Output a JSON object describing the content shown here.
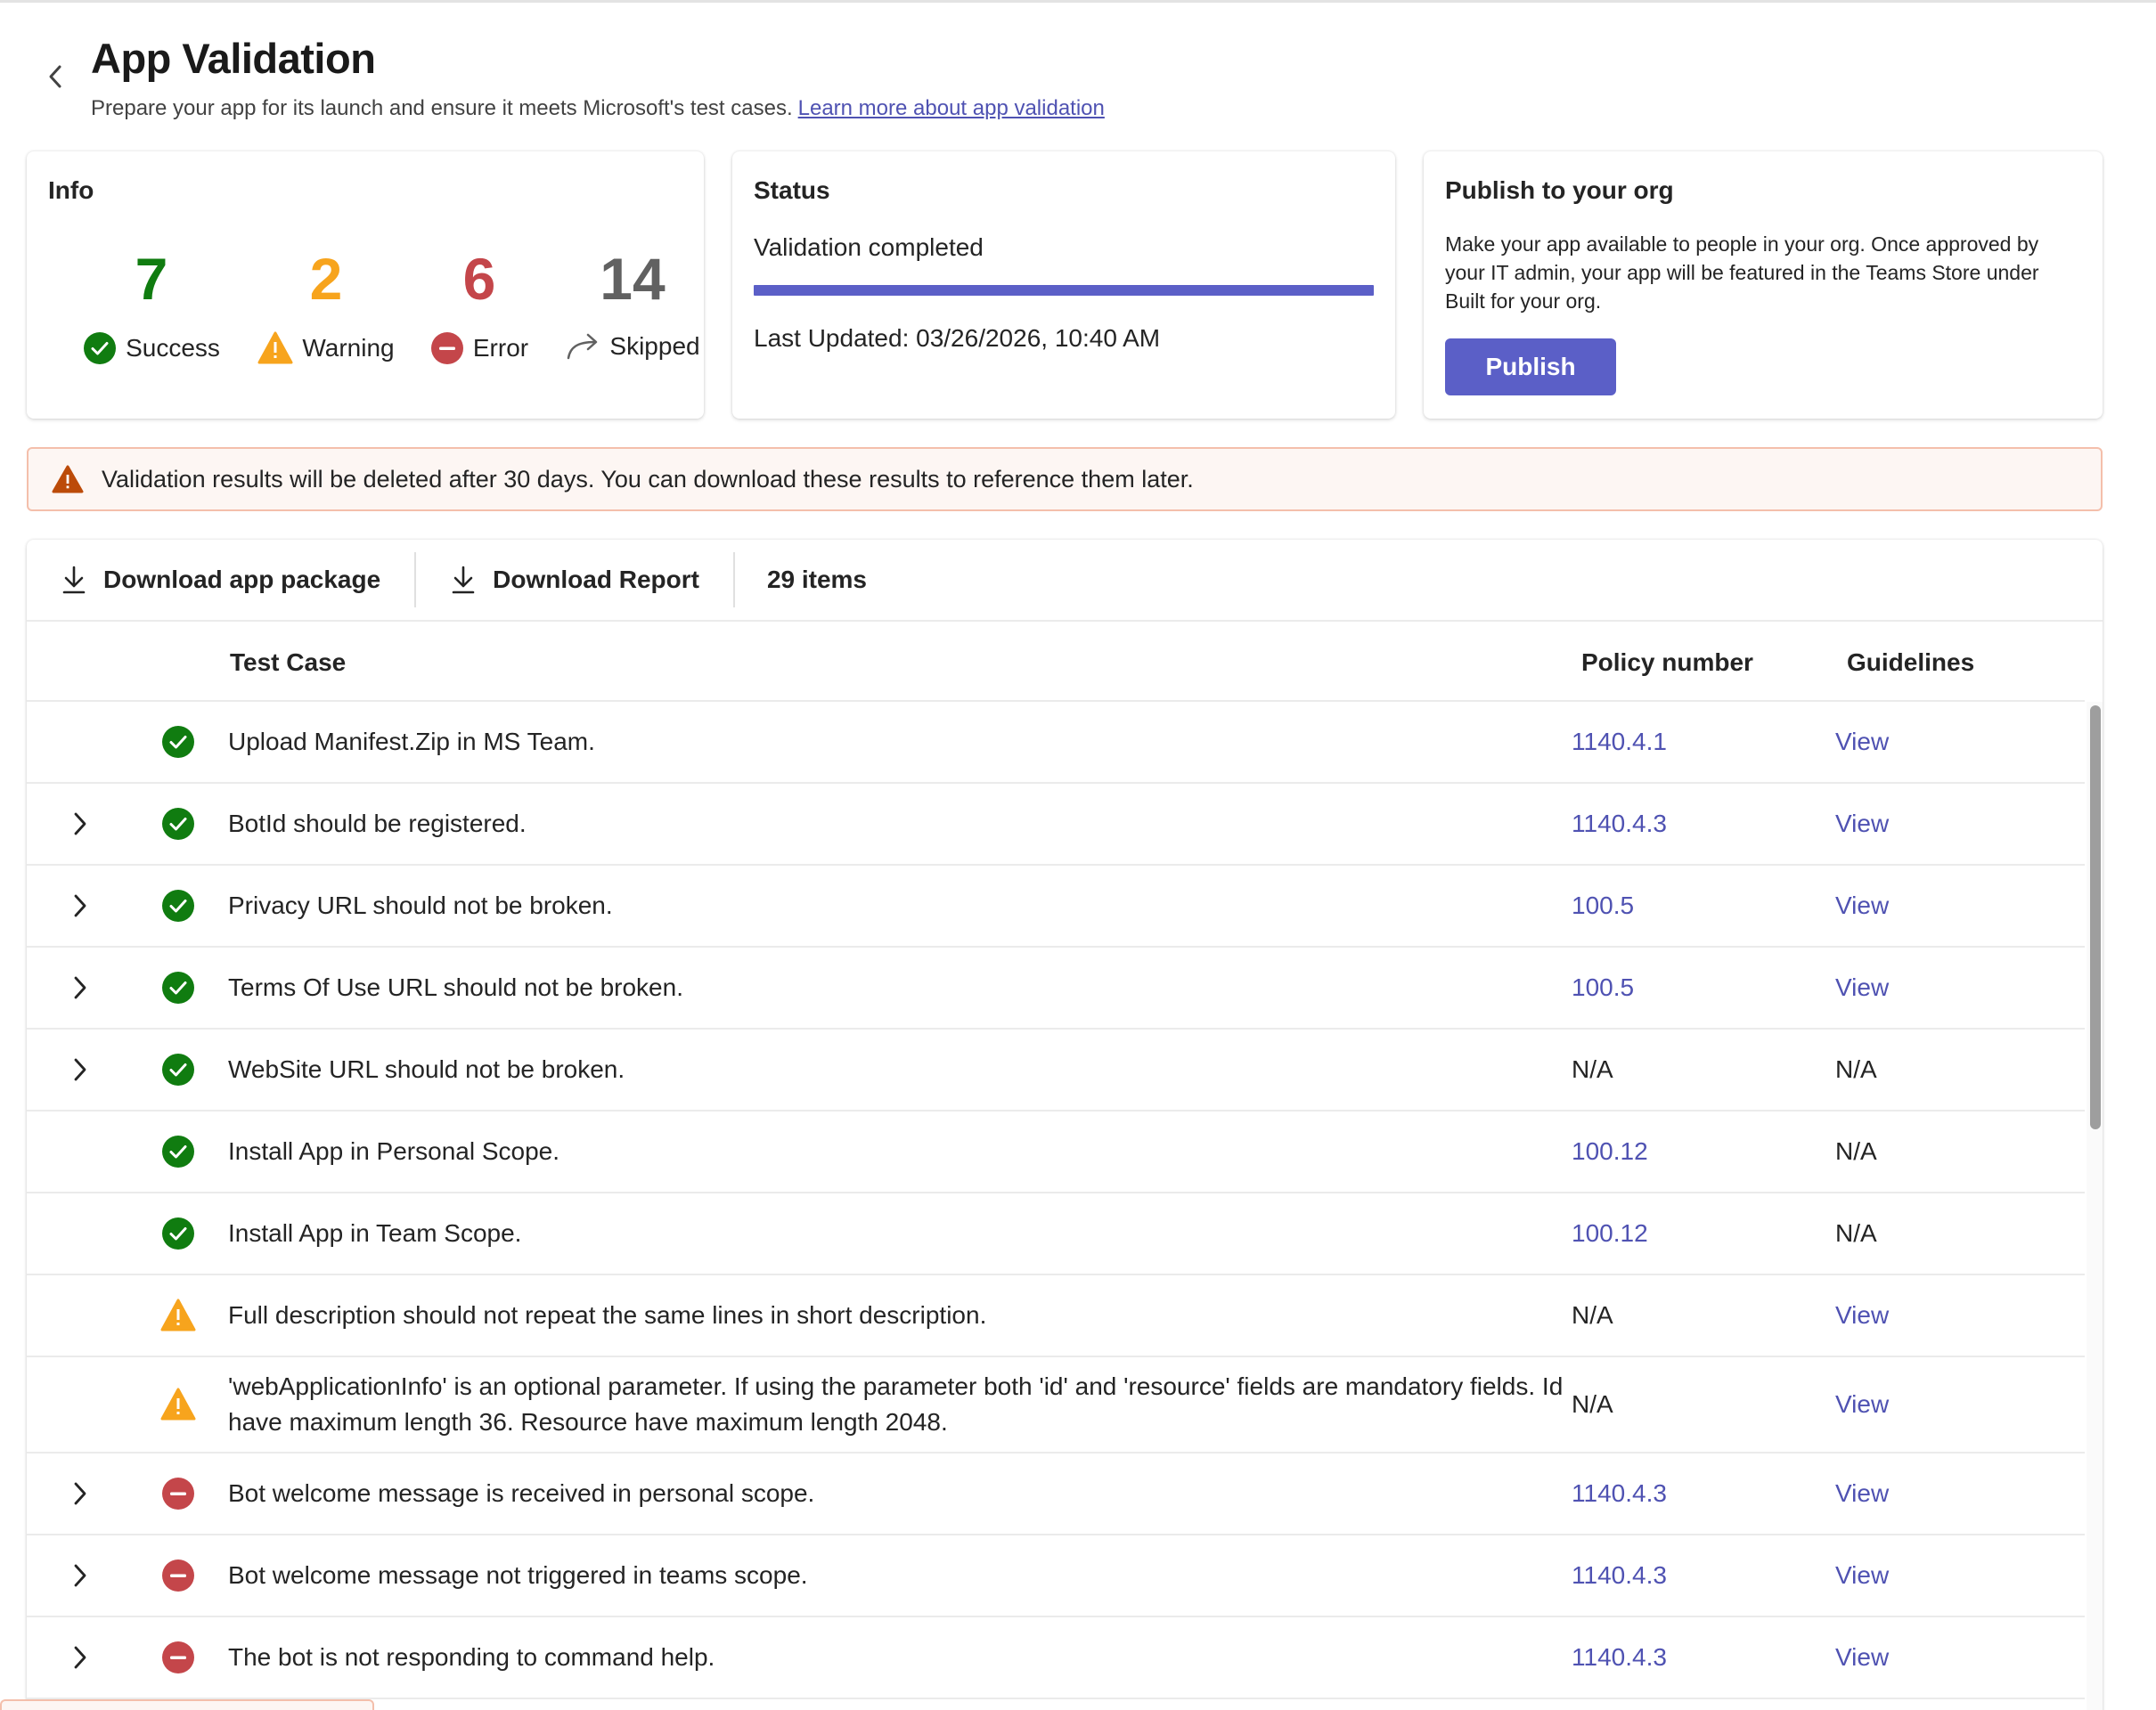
{
  "header": {
    "title": "App Validation",
    "subtitle": "Prepare your app for its launch and ensure it meets Microsoft's test cases.",
    "learn_more": "Learn more about app validation"
  },
  "info": {
    "title": "Info",
    "success": {
      "count": "7",
      "label": "Success"
    },
    "warning": {
      "count": "2",
      "label": "Warning"
    },
    "error": {
      "count": "6",
      "label": "Error"
    },
    "skipped": {
      "count": "14",
      "label": "Skipped"
    }
  },
  "status": {
    "title": "Status",
    "text": "Validation completed",
    "progress": 1.0,
    "last_updated": "Last Updated: 03/26/2026, 10:40 AM"
  },
  "publish": {
    "title": "Publish to your org",
    "description": "Make your app available to people in your org. Once approved by your IT admin, your app will be featured in the Teams Store under Built for your org.",
    "button": "Publish"
  },
  "banner": {
    "text": "Validation results will be deleted after 30 days. You can download these results to reference them later."
  },
  "toolbar": {
    "download_package": "Download app package",
    "download_report": "Download Report",
    "items_count": "29 items"
  },
  "table": {
    "headers": {
      "test_case": "Test Case",
      "policy": "Policy number",
      "guidelines": "Guidelines"
    },
    "rows": [
      {
        "status": "success",
        "expandable": false,
        "test_case": "Upload Manifest.Zip in MS Team.",
        "policy": "1140.4.1",
        "policy_link": true,
        "guidelines": "View",
        "guidelines_link": true
      },
      {
        "status": "success",
        "expandable": true,
        "test_case": "BotId should be registered.",
        "policy": "1140.4.3",
        "policy_link": true,
        "guidelines": "View",
        "guidelines_link": true
      },
      {
        "status": "success",
        "expandable": true,
        "test_case": "Privacy URL should not be broken.",
        "policy": "100.5",
        "policy_link": true,
        "guidelines": "View",
        "guidelines_link": true
      },
      {
        "status": "success",
        "expandable": true,
        "test_case": "Terms Of Use URL should not be broken.",
        "policy": "100.5",
        "policy_link": true,
        "guidelines": "View",
        "guidelines_link": true
      },
      {
        "status": "success",
        "expandable": true,
        "test_case": "WebSite URL should not be broken.",
        "policy": "N/A",
        "policy_link": false,
        "guidelines": "N/A",
        "guidelines_link": false
      },
      {
        "status": "success",
        "expandable": false,
        "test_case": "Install App in Personal Scope.",
        "policy": "100.12",
        "policy_link": true,
        "guidelines": "N/A",
        "guidelines_link": false
      },
      {
        "status": "success",
        "expandable": false,
        "test_case": "Install App in Team Scope.",
        "policy": "100.12",
        "policy_link": true,
        "guidelines": "N/A",
        "guidelines_link": false
      },
      {
        "status": "warning",
        "expandable": false,
        "test_case": "Full description should not repeat the same lines in short description.",
        "policy": "N/A",
        "policy_link": false,
        "guidelines": "View",
        "guidelines_link": true
      },
      {
        "status": "warning",
        "expandable": false,
        "tall": true,
        "test_case": "'webApplicationInfo' is an optional parameter. If using the parameter both 'id' and 'resource' fields are mandatory fields. Id have maximum length 36. Resource have maximum length 2048.",
        "policy": "N/A",
        "policy_link": false,
        "guidelines": "View",
        "guidelines_link": true
      },
      {
        "status": "error",
        "expandable": true,
        "test_case": "Bot welcome message is received in personal scope.",
        "policy": "1140.4.3",
        "policy_link": true,
        "guidelines": "View",
        "guidelines_link": true
      },
      {
        "status": "error",
        "expandable": true,
        "test_case": "Bot welcome message not triggered in teams scope.",
        "policy": "1140.4.3",
        "policy_link": true,
        "guidelines": "View",
        "guidelines_link": true
      },
      {
        "status": "error",
        "expandable": true,
        "test_case": "The bot is not responding to command help.",
        "policy": "1140.4.3",
        "policy_link": true,
        "guidelines": "View",
        "guidelines_link": true
      }
    ]
  },
  "colors": {
    "accent": "#5b5fc7",
    "link": "#4f52b2",
    "success": "#107c10",
    "warning": "#f7a41d",
    "error": "#c4464a",
    "skipped": "#616161",
    "banner_icon": "#bc4b09"
  },
  "icons": {
    "back": "chevron-left-icon",
    "success": "check-circle-icon",
    "warning": "warning-triangle-icon",
    "error": "minus-circle-icon",
    "skipped": "arrow-forward-icon",
    "download": "download-icon",
    "expand": "chevron-right-icon"
  }
}
